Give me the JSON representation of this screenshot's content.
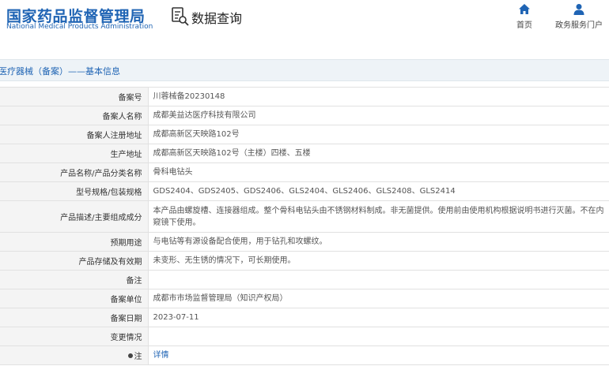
{
  "header": {
    "logo_cn": "国家药品监督管理局",
    "logo_en": "National Medical Products Administration",
    "site_title": "数据查询",
    "site_icon": "document-search-icon"
  },
  "nav": {
    "home_label": "首页",
    "home_icon": "home-icon",
    "service_label": "政务服务门户",
    "service_icon": "user-icon"
  },
  "breadcrumb": "医疗器械（备案）——基本信息",
  "rows": [
    {
      "label": "备案号",
      "value": "川蓉械备20230148"
    },
    {
      "label": "备案人名称",
      "value": "成都美益达医疗科技有限公司"
    },
    {
      "label": "备案人注册地址",
      "value": "成都高新区天映路102号"
    },
    {
      "label": "生产地址",
      "value": "成都高新区天映路102号（主楼）四楼、五楼"
    },
    {
      "label": "产品名称/产品分类名称",
      "value": "骨科电钻头"
    },
    {
      "label": "型号规格/包装规格",
      "value": "GDS2404、GDS2405、GDS2406、GLS2404、GLS2406、GLS2408、GLS2414"
    },
    {
      "label": "产品描述/主要组成成分",
      "value": "本产品由螺旋槽、连接器组成。整个骨科电钻头由不锈钢材料制成。非无菌提供。使用前由使用机构根据说明书进行灭菌。不在内窥镜下使用。"
    },
    {
      "label": "预期用途",
      "value": "与电钻等有源设备配合使用，用于钻孔和攻螺纹。"
    },
    {
      "label": "产品存储及有效期",
      "value": "未变形、无生锈的情况下，可长期使用。"
    },
    {
      "label": "备注",
      "value": ""
    },
    {
      "label": "备案单位",
      "value": "成都市市场监督管理局（知识产权局）"
    },
    {
      "label": "备案日期",
      "value": "2023-07-11"
    },
    {
      "label": "变更情况",
      "value": ""
    },
    {
      "label": "注",
      "value": "详情"
    }
  ],
  "colors": {
    "brand_blue": "#1f64b4",
    "label_bg": "#f4f4f4",
    "breadcrumb_bg": "#eef3f7"
  }
}
